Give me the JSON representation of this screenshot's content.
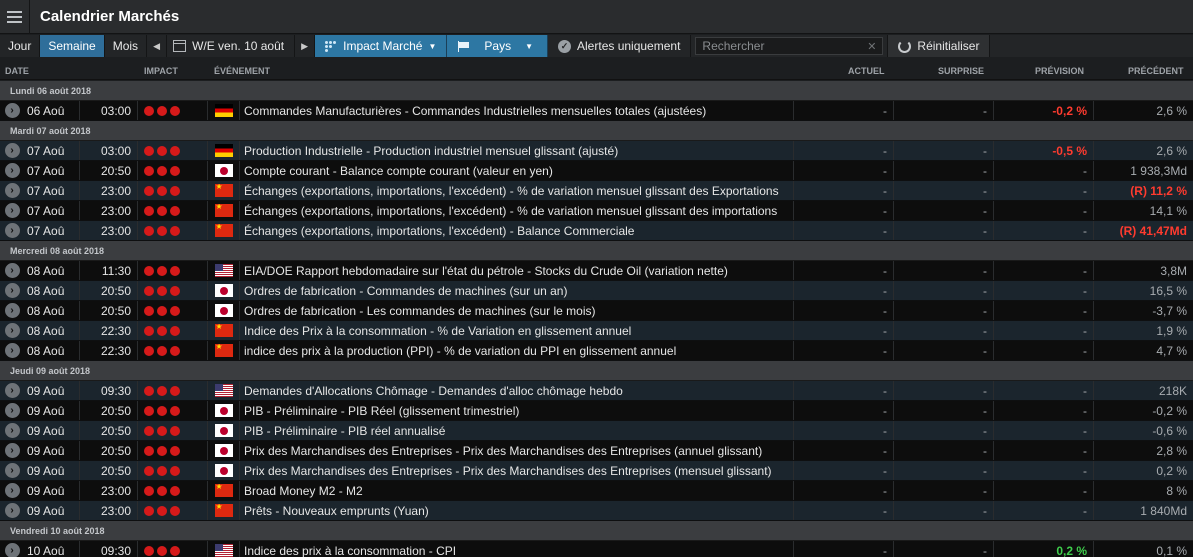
{
  "app": {
    "title": "Calendrier Marchés"
  },
  "toolbar": {
    "day": "Jour",
    "week": "Semaine",
    "month": "Mois",
    "date_label": "W/E ven. 10 août",
    "impact_label": "Impact Marché",
    "country_label": "Pays",
    "alerts_label": "Alertes uniquement",
    "search_placeholder": "Rechercher",
    "reset_label": "Réinitialiser"
  },
  "columns": {
    "date": "DATE",
    "impact": "IMPACT",
    "event": "ÉVÉNEMENT",
    "actual": "ACTUEL",
    "surprise": "SURPRISE",
    "forecast": "PRÉVISION",
    "previous": "PRÉCÉDENT"
  },
  "colors": {
    "accent": "#2f6e9a",
    "negative": "#ff3b2f",
    "positive": "#3fce4c",
    "impact_dot": "#d61a1a"
  },
  "days": [
    {
      "label": "Lundi 06 août 2018",
      "events": [
        {
          "date": "06 Aoû",
          "time": "03:00",
          "flag": "de",
          "event": "Commandes Manufacturières - Commandes Industrielles mensuelles totales (ajustées)",
          "actual": "-",
          "surprise": "-",
          "forecast": "-0,2 %",
          "forecast_style": "neg",
          "previous": "2,6 %",
          "previous_style": "muted"
        }
      ]
    },
    {
      "label": "Mardi 07 août 2018",
      "events": [
        {
          "date": "07 Aoû",
          "time": "03:00",
          "flag": "de",
          "event": "Production Industrielle - Production industriel mensuel glissant (ajusté)",
          "actual": "-",
          "surprise": "-",
          "forecast": "-0,5 %",
          "forecast_style": "neg",
          "previous": "2,6 %",
          "previous_style": "muted"
        },
        {
          "date": "07 Aoû",
          "time": "20:50",
          "flag": "jp",
          "event": "Compte courant - Balance compte courant (valeur en yen)",
          "actual": "-",
          "surprise": "-",
          "forecast": "-",
          "forecast_style": "muted",
          "previous": "1 938,3Md",
          "previous_style": "muted"
        },
        {
          "date": "07 Aoû",
          "time": "23:00",
          "flag": "cn",
          "event": "Échanges (exportations, importations, l'excédent) - % de variation mensuel glissant des Exportations",
          "actual": "-",
          "surprise": "-",
          "forecast": "-",
          "forecast_style": "muted",
          "previous": "(R) 11,2 %",
          "previous_style": "neg"
        },
        {
          "date": "07 Aoû",
          "time": "23:00",
          "flag": "cn",
          "event": "Échanges (exportations, importations, l'excédent) - % de variation mensuel glissant des importations",
          "actual": "-",
          "surprise": "-",
          "forecast": "-",
          "forecast_style": "muted",
          "previous": "14,1 %",
          "previous_style": "muted"
        },
        {
          "date": "07 Aoû",
          "time": "23:00",
          "flag": "cn",
          "event": "Échanges (exportations, importations, l'excédent) - Balance Commerciale",
          "actual": "-",
          "surprise": "-",
          "forecast": "-",
          "forecast_style": "muted",
          "previous": "(R) 41,47Md",
          "previous_style": "neg"
        }
      ]
    },
    {
      "label": "Mercredi 08 août 2018",
      "events": [
        {
          "date": "08 Aoû",
          "time": "11:30",
          "flag": "us",
          "event": "EIA/DOE Rapport hebdomadaire sur l'état du pétrole - Stocks du Crude Oil (variation nette)",
          "actual": "-",
          "surprise": "-",
          "forecast": "-",
          "forecast_style": "muted",
          "previous": "3,8M",
          "previous_style": "muted"
        },
        {
          "date": "08 Aoû",
          "time": "20:50",
          "flag": "jp",
          "event": "Ordres de fabrication - Commandes de machines (sur un an)",
          "actual": "-",
          "surprise": "-",
          "forecast": "-",
          "forecast_style": "muted",
          "previous": "16,5 %",
          "previous_style": "muted"
        },
        {
          "date": "08 Aoû",
          "time": "20:50",
          "flag": "jp",
          "event": "Ordres de fabrication - Les commandes de machines (sur le mois)",
          "actual": "-",
          "surprise": "-",
          "forecast": "-",
          "forecast_style": "muted",
          "previous": "-3,7 %",
          "previous_style": "muted"
        },
        {
          "date": "08 Aoû",
          "time": "22:30",
          "flag": "cn",
          "event": "Indice des Prix à la consommation - % de Variation en glissement annuel",
          "actual": "-",
          "surprise": "-",
          "forecast": "-",
          "forecast_style": "muted",
          "previous": "1,9 %",
          "previous_style": "muted"
        },
        {
          "date": "08 Aoû",
          "time": "22:30",
          "flag": "cn",
          "event": "indice des prix à la production (PPI) - % de variation du PPI en glissement annuel",
          "actual": "-",
          "surprise": "-",
          "forecast": "-",
          "forecast_style": "muted",
          "previous": "4,7 %",
          "previous_style": "muted"
        }
      ]
    },
    {
      "label": "Jeudi 09 août 2018",
      "events": [
        {
          "date": "09 Aoû",
          "time": "09:30",
          "flag": "us",
          "event": "Demandes d'Allocations Chômage - Demandes d'alloc chômage hebdo",
          "actual": "-",
          "surprise": "-",
          "forecast": "-",
          "forecast_style": "muted",
          "previous": "218K",
          "previous_style": "muted"
        },
        {
          "date": "09 Aoû",
          "time": "20:50",
          "flag": "jp",
          "event": "PIB - Préliminaire - PIB Réel (glissement trimestriel)",
          "actual": "-",
          "surprise": "-",
          "forecast": "-",
          "forecast_style": "muted",
          "previous": "-0,2 %",
          "previous_style": "muted"
        },
        {
          "date": "09 Aoû",
          "time": "20:50",
          "flag": "jp",
          "event": "PIB - Préliminaire - PIB réel annualisé",
          "actual": "-",
          "surprise": "-",
          "forecast": "-",
          "forecast_style": "muted",
          "previous": "-0,6 %",
          "previous_style": "muted"
        },
        {
          "date": "09 Aoû",
          "time": "20:50",
          "flag": "jp",
          "event": "Prix des Marchandises des Entreprises - Prix des Marchandises des Entreprises (annuel glissant)",
          "actual": "-",
          "surprise": "-",
          "forecast": "-",
          "forecast_style": "muted",
          "previous": "2,8 %",
          "previous_style": "muted"
        },
        {
          "date": "09 Aoû",
          "time": "20:50",
          "flag": "jp",
          "event": "Prix des Marchandises des Entreprises - Prix des Marchandises des Entreprises (mensuel glissant)",
          "actual": "-",
          "surprise": "-",
          "forecast": "-",
          "forecast_style": "muted",
          "previous": "0,2 %",
          "previous_style": "muted"
        },
        {
          "date": "09 Aoû",
          "time": "23:00",
          "flag": "cn",
          "event": "Broad Money M2 - M2",
          "actual": "-",
          "surprise": "-",
          "forecast": "-",
          "forecast_style": "muted",
          "previous": "8 %",
          "previous_style": "muted"
        },
        {
          "date": "09 Aoû",
          "time": "23:00",
          "flag": "cn",
          "event": "Prêts - Nouveaux emprunts (Yuan)",
          "actual": "-",
          "surprise": "-",
          "forecast": "-",
          "forecast_style": "muted",
          "previous": "1 840Md",
          "previous_style": "muted"
        }
      ]
    },
    {
      "label": "Vendredi 10 août 2018",
      "events": [
        {
          "date": "10 Aoû",
          "time": "09:30",
          "flag": "us",
          "event": "Indice des prix à la consommation - CPI",
          "actual": "-",
          "surprise": "-",
          "forecast": "0,2 %",
          "forecast_style": "pos",
          "previous": "0,1 %",
          "previous_style": "muted"
        }
      ]
    }
  ]
}
